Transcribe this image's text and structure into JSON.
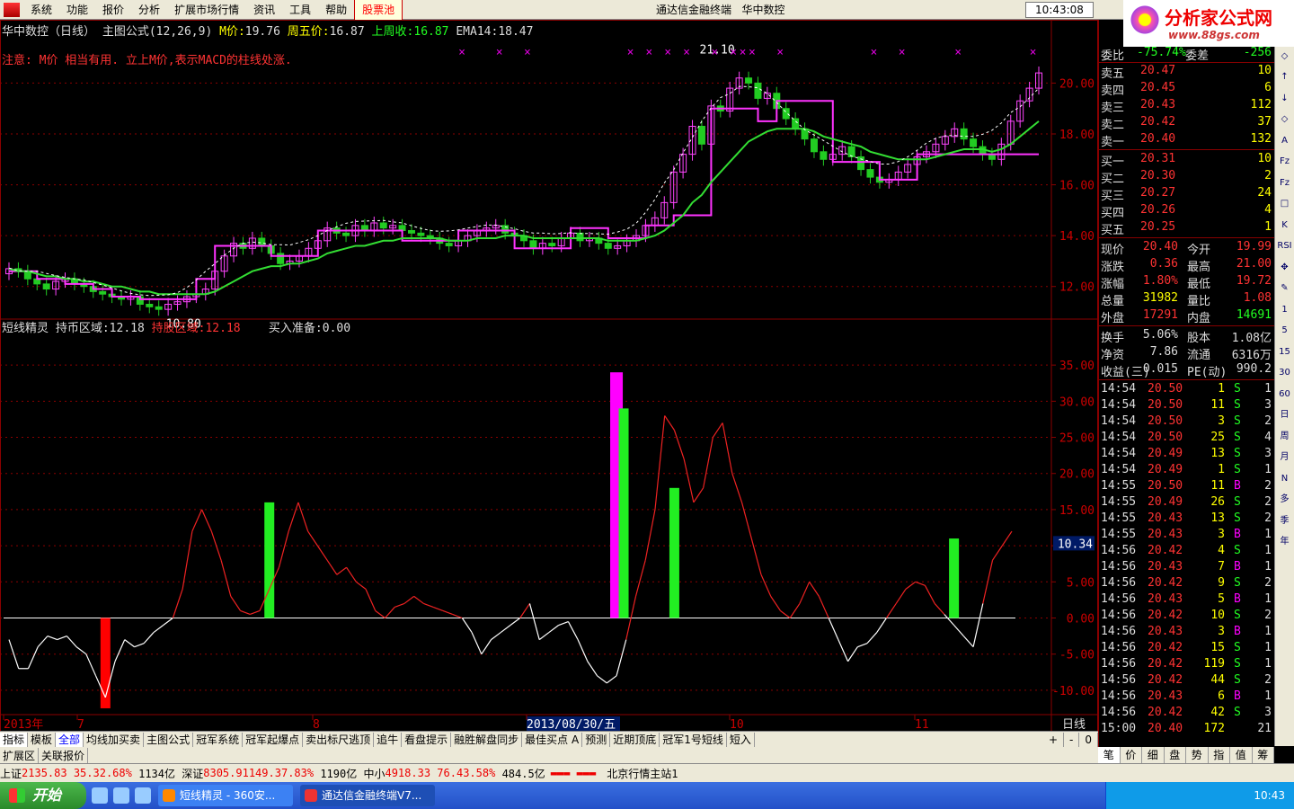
{
  "menu": {
    "items": [
      "系统",
      "功能",
      "报价",
      "分析",
      "扩展市场行情",
      "资讯",
      "工具",
      "帮助"
    ],
    "hot": "股票池",
    "title": [
      "通达信金融终端",
      "华中数控"
    ],
    "clock": "10:43:08",
    "trade_btn": "行",
    "brand_title": "分析家公式网",
    "brand_url": "www.88gs.com"
  },
  "main_header": {
    "stock": "华中数控（日线）",
    "formula": "主图公式(12,26,9)",
    "m_label": "M价:",
    "m_value": "19.76",
    "fri_label": "周五价:",
    "fri_value": "16.87",
    "lastweek_label": "上周收:",
    "lastweek_value": "16.87",
    "ema_label": "EMA14:",
    "ema_value": "18.47",
    "note": "注意:  M价 相当有用. 立上M价,表示MACD的柱线处涨."
  },
  "sub_header": {
    "name": "短线精灵",
    "hold_coin_label": "持币区域:",
    "hold_coin_value": "12.18",
    "hold_stock_label": "持股区域:",
    "hold_stock_value": "12.18",
    "buy_label": "买入准备:",
    "buy_value": "0.00"
  },
  "colors": {
    "up": "#ff44ff",
    "down": "#22cc22",
    "ema": "#33dd33",
    "mline": "#ff33ff",
    "buy": "#22ee22",
    "sell": "#ff0000",
    "grid": "#8b0000"
  },
  "chart_data": [
    {
      "type": "candlestick",
      "title": "",
      "ylim": [
        11.0,
        21.5
      ],
      "y_ticks": [
        12.0,
        14.0,
        16.0,
        18.0,
        20.0
      ],
      "annotations": [
        {
          "label": "21.10"
        },
        {
          "label": "10.80"
        }
      ],
      "close": [
        12.7,
        12.6,
        12.3,
        12.1,
        11.9,
        12.2,
        12.3,
        12.1,
        12.0,
        11.8,
        11.7,
        11.6,
        11.5,
        11.6,
        11.3,
        11.2,
        11.1,
        11.3,
        11.4,
        11.6,
        11.7,
        11.9,
        12.6,
        13.2,
        13.7,
        13.5,
        13.9,
        13.6,
        13.3,
        12.9,
        13.0,
        13.2,
        13.5,
        13.8,
        14.3,
        14.1,
        14.0,
        14.4,
        14.2,
        14.5,
        14.3,
        14.4,
        14.2,
        14.1,
        14.0,
        13.9,
        13.7,
        13.6,
        13.8,
        14.0,
        14.2,
        14.3,
        14.4,
        14.1,
        14.0,
        13.8,
        13.5,
        13.7,
        13.6,
        13.9,
        14.1,
        13.8,
        13.9,
        13.7,
        13.5,
        13.6,
        13.8,
        14.0,
        14.4,
        14.7,
        15.3,
        16.5,
        17.2,
        18.3,
        17.6,
        19.1,
        18.9,
        19.8,
        20.2,
        20.0,
        19.4,
        19.6,
        19.0,
        18.6,
        18.2,
        17.8,
        17.3,
        17.0,
        17.2,
        17.5,
        17.1,
        16.6,
        16.3,
        16.1,
        16.2,
        16.5,
        16.8,
        17.1,
        17.3,
        17.6,
        17.9,
        18.2,
        17.8,
        17.5,
        17.2,
        17.0,
        17.6,
        18.5,
        19.3,
        19.8,
        20.4
      ],
      "m_line": [
        12.6,
        12.6,
        12.6,
        12.3,
        12.3,
        12.3,
        12.1,
        12.1,
        12.1,
        11.9,
        11.9,
        11.6,
        11.6,
        11.6,
        11.5,
        11.5,
        11.5,
        11.5,
        11.5,
        11.5,
        12.3,
        12.3,
        13.6,
        13.6,
        13.6,
        13.6,
        13.6,
        13.6,
        13.2,
        13.2,
        13.2,
        13.2,
        13.2,
        14.2,
        14.2,
        14.2,
        14.2,
        14.2,
        14.2,
        14.2,
        14.2,
        14.2,
        13.8,
        13.8,
        13.8,
        13.8,
        13.8,
        13.8,
        14.2,
        14.2,
        14.2,
        14.2,
        14.2,
        14.2,
        13.5,
        13.5,
        13.5,
        13.5,
        13.5,
        13.5,
        14.3,
        14.3,
        14.3,
        14.3,
        13.9,
        13.9,
        13.9,
        13.9,
        14.4,
        14.4,
        14.4,
        14.8,
        14.8,
        14.8,
        14.8,
        19.0,
        19.0,
        19.0,
        19.0,
        19.0,
        18.5,
        18.5,
        19.3,
        19.3,
        19.3,
        19.3,
        19.3,
        19.3,
        16.9,
        16.9,
        16.9,
        16.9,
        16.9,
        16.2,
        16.2,
        16.2,
        16.2,
        17.2,
        17.2,
        17.2,
        17.2,
        17.2,
        17.2,
        17.2,
        17.2,
        17.2,
        17.2,
        17.2,
        17.2,
        17.2,
        17.2
      ],
      "ema14": [
        12.7,
        12.6,
        12.6,
        12.5,
        12.4,
        12.4,
        12.3,
        12.3,
        12.2,
        12.2,
        12.1,
        12.0,
        12.0,
        11.9,
        11.8,
        11.8,
        11.7,
        11.7,
        11.7,
        11.7,
        11.7,
        11.7,
        11.8,
        12.0,
        12.2,
        12.4,
        12.6,
        12.7,
        12.8,
        12.8,
        12.9,
        12.9,
        13.0,
        13.1,
        13.3,
        13.4,
        13.5,
        13.6,
        13.6,
        13.7,
        13.8,
        13.8,
        13.9,
        13.9,
        13.9,
        13.9,
        13.9,
        13.8,
        13.8,
        13.8,
        13.9,
        13.9,
        13.9,
        14.0,
        14.0,
        14.0,
        13.9,
        13.9,
        13.9,
        13.9,
        13.9,
        13.9,
        13.9,
        13.9,
        13.8,
        13.8,
        13.8,
        13.8,
        13.9,
        14.0,
        14.2,
        14.5,
        14.8,
        15.3,
        15.6,
        16.1,
        16.5,
        16.9,
        17.3,
        17.7,
        17.9,
        18.1,
        18.2,
        18.2,
        18.2,
        18.2,
        18.1,
        17.9,
        17.8,
        17.7,
        17.6,
        17.5,
        17.3,
        17.2,
        17.1,
        17.0,
        17.0,
        17.0,
        17.0,
        17.1,
        17.2,
        17.3,
        17.4,
        17.4,
        17.4,
        17.3,
        17.4,
        17.6,
        17.9,
        18.2,
        18.5
      ]
    },
    {
      "type": "line",
      "title": "",
      "ylim": [
        -13.0,
        39.0
      ],
      "y_ticks": [
        -10.0,
        -5.0,
        0.0,
        5.0,
        10.0,
        15.0,
        20.0,
        25.0,
        30.0,
        35.0
      ],
      "current_value": "10.34",
      "values": [
        -3,
        -7,
        -7,
        -4,
        -2.5,
        -3,
        -2.5,
        -4,
        -5,
        -8,
        -11,
        -6,
        -3,
        -4,
        -3.5,
        -2,
        -1,
        0,
        4,
        12,
        15,
        12,
        8,
        3,
        1,
        0.5,
        1,
        4,
        7,
        12,
        16,
        12,
        10,
        8,
        6,
        7,
        5,
        4,
        1,
        0,
        1.5,
        2,
        3,
        2,
        1.5,
        1,
        0.5,
        0,
        -2,
        -5,
        -3,
        -2,
        -1,
        0,
        2,
        -3,
        -2,
        -1,
        -0.5,
        -3,
        -6,
        -8,
        -9,
        -8,
        -3,
        3,
        8,
        15,
        28,
        26,
        22,
        16,
        18,
        25,
        27,
        20,
        16,
        11,
        6,
        3,
        1,
        0,
        2,
        5,
        3,
        0,
        -3,
        -6,
        -4,
        -3.5,
        -2,
        0,
        2,
        4,
        5,
        4.5,
        2,
        0.5,
        -1,
        -2.5,
        -4,
        2,
        8,
        10,
        12
      ],
      "signals": [
        {
          "kind": "sell",
          "index": 10,
          "top": 0.0,
          "bottom": -12.5
        },
        {
          "kind": "buy",
          "index": 27,
          "top": 16.0,
          "bottom": 0.0
        },
        {
          "kind": "buy_strong",
          "index": 63,
          "top": 34.0,
          "bottom": 0.0
        },
        {
          "kind": "buy",
          "index": 63,
          "top": 29.0,
          "bottom": 0.0
        },
        {
          "kind": "buy",
          "index": 69,
          "top": 18.0,
          "bottom": 0.0
        },
        {
          "kind": "buy",
          "index": 98,
          "top": 11.0,
          "bottom": 0.0
        }
      ]
    }
  ],
  "x_axis": {
    "labels": [
      "2013年",
      "7",
      "8",
      "2013/08/30/五",
      "10",
      "11"
    ],
    "period": "日线"
  },
  "quotes": {
    "ratio": {
      "label": "委比",
      "value": "-75.74%",
      "label2": "委差",
      "value2": "-256"
    },
    "asks": [
      {
        "label": "卖五",
        "price": "20.47",
        "vol": "10"
      },
      {
        "label": "卖四",
        "price": "20.45",
        "vol": "6"
      },
      {
        "label": "卖三",
        "price": "20.43",
        "vol": "112"
      },
      {
        "label": "卖二",
        "price": "20.42",
        "vol": "37"
      },
      {
        "label": "卖一",
        "price": "20.40",
        "vol": "132"
      }
    ],
    "bids": [
      {
        "label": "买一",
        "price": "20.31",
        "vol": "10"
      },
      {
        "label": "买二",
        "price": "20.30",
        "vol": "2"
      },
      {
        "label": "买三",
        "price": "20.27",
        "vol": "24"
      },
      {
        "label": "买四",
        "price": "20.26",
        "vol": "4"
      },
      {
        "label": "买五",
        "price": "20.25",
        "vol": "1"
      }
    ],
    "stats": [
      {
        "l1": "现价",
        "v1": "20.40",
        "l2": "今开",
        "v2": "19.99"
      },
      {
        "l1": "涨跌",
        "v1": "0.36",
        "l2": "最高",
        "v2": "21.00"
      },
      {
        "l1": "涨幅",
        "v1": "1.80%",
        "l2": "最低",
        "v2": "19.72"
      },
      {
        "l1": "总量",
        "v1": "31982",
        "l2": "量比",
        "v2": "1.08"
      },
      {
        "l1": "外盘",
        "v1": "17291",
        "l2": "内盘",
        "v2": "14691"
      }
    ],
    "stats2": [
      {
        "l1": "换手",
        "v1": "5.06%",
        "l2": "股本",
        "v2": "1.08亿"
      },
      {
        "l1": "净资",
        "v1": "7.86",
        "l2": "流通",
        "v2": "6316万"
      },
      {
        "l1": "收益(三)",
        "v1": "0.015",
        "l2": "PE(动)",
        "v2": "990.2"
      }
    ],
    "ticks": [
      {
        "t": "14:54",
        "p": "20.50",
        "v": "1",
        "s": "S",
        "n": "1"
      },
      {
        "t": "14:54",
        "p": "20.50",
        "v": "11",
        "s": "S",
        "n": "3"
      },
      {
        "t": "14:54",
        "p": "20.50",
        "v": "3",
        "s": "S",
        "n": "2"
      },
      {
        "t": "14:54",
        "p": "20.50",
        "v": "25",
        "s": "S",
        "n": "4"
      },
      {
        "t": "14:54",
        "p": "20.49",
        "v": "13",
        "s": "S",
        "n": "3"
      },
      {
        "t": "14:54",
        "p": "20.49",
        "v": "1",
        "s": "S",
        "n": "1"
      },
      {
        "t": "14:55",
        "p": "20.50",
        "v": "11",
        "s": "B",
        "n": "2"
      },
      {
        "t": "14:55",
        "p": "20.49",
        "v": "26",
        "s": "S",
        "n": "2"
      },
      {
        "t": "14:55",
        "p": "20.43",
        "v": "13",
        "s": "S",
        "n": "2"
      },
      {
        "t": "14:55",
        "p": "20.43",
        "v": "3",
        "s": "B",
        "n": "1"
      },
      {
        "t": "14:56",
        "p": "20.42",
        "v": "4",
        "s": "S",
        "n": "1"
      },
      {
        "t": "14:56",
        "p": "20.43",
        "v": "7",
        "s": "B",
        "n": "1"
      },
      {
        "t": "14:56",
        "p": "20.42",
        "v": "9",
        "s": "S",
        "n": "2"
      },
      {
        "t": "14:56",
        "p": "20.43",
        "v": "5",
        "s": "B",
        "n": "1"
      },
      {
        "t": "14:56",
        "p": "20.42",
        "v": "10",
        "s": "S",
        "n": "2"
      },
      {
        "t": "14:56",
        "p": "20.43",
        "v": "3",
        "s": "B",
        "n": "1"
      },
      {
        "t": "14:56",
        "p": "20.42",
        "v": "15",
        "s": "S",
        "n": "1"
      },
      {
        "t": "14:56",
        "p": "20.42",
        "v": "119",
        "s": "S",
        "n": "1"
      },
      {
        "t": "14:56",
        "p": "20.42",
        "v": "44",
        "s": "S",
        "n": "2"
      },
      {
        "t": "14:56",
        "p": "20.43",
        "v": "6",
        "s": "B",
        "n": "1"
      },
      {
        "t": "14:56",
        "p": "20.42",
        "v": "42",
        "s": "S",
        "n": "3"
      },
      {
        "t": "15:00",
        "p": "20.40",
        "v": "172",
        "s": "",
        "n": "21"
      }
    ]
  },
  "tabs": [
    "指标",
    "模板",
    "全部",
    "均线加买卖",
    "主图公式",
    "冠军系统",
    "冠军起爆点",
    "卖出标尺逃顶",
    "追牛",
    "看盘提示",
    "融胜解盘同步",
    "最佳买点 A",
    "预测",
    "近期顶底",
    "冠军1号短线",
    "短入"
  ],
  "tab_controls": [
    "+",
    "-",
    "0"
  ],
  "subtabs": [
    "扩展区",
    "关联报价"
  ],
  "right_tabs": [
    "笔",
    "价",
    "细",
    "盘",
    "势",
    "指",
    "值",
    "筹"
  ],
  "iconbar": [
    "◇",
    "◇",
    "↑",
    "↓",
    "◇",
    "A",
    "Fz",
    "Fz",
    "□",
    "K",
    "RSI",
    "✥",
    "✎",
    "1",
    "5",
    "15",
    "30",
    "60",
    "日",
    "周",
    "月",
    "N",
    "多",
    "季",
    "年"
  ],
  "status": {
    "sh_label": "上证",
    "sh_value": "2135.83",
    "sh_chg": "35.32",
    "sh_pct": ".68%",
    "sh_amt": "1134亿",
    "sz_label": "深证",
    "sz_value": "8305.91",
    "sz_chg": "149.37",
    "sz_pct": ".83%",
    "sz_amt": "1190亿",
    "zx_label": "中小",
    "zx_value": "4918.33",
    "zx_chg": "76.43",
    "zx_pct": ".58%",
    "zx_amt": "484.5亿",
    "server": "北京行情主站1"
  },
  "taskbar": {
    "start": "开始",
    "tasks": [
      "短线精灵 - 360安...",
      "通达信金融终端V7..."
    ],
    "time": "10:43"
  }
}
